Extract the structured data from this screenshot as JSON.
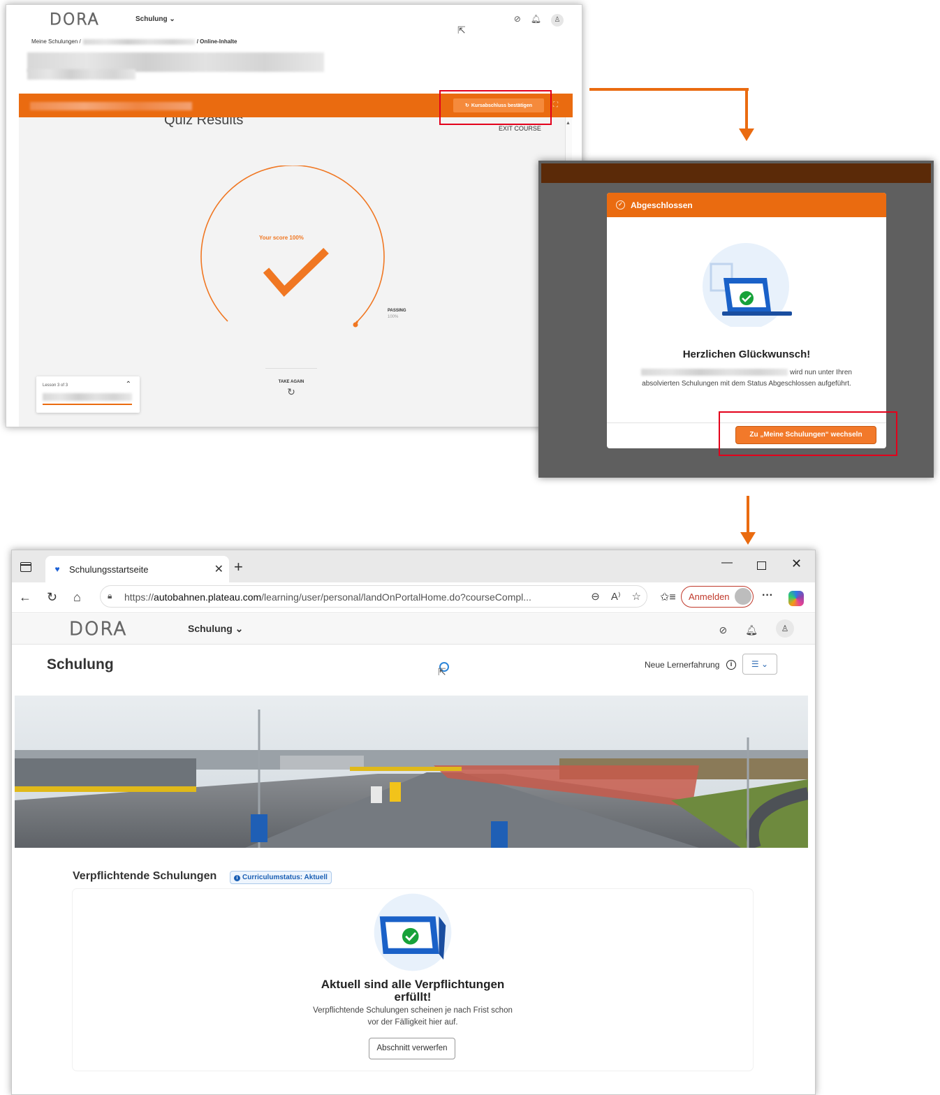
{
  "colors": {
    "accent": "#ea6b10",
    "highlight_box": "#e3001b",
    "link_blue": "#1a5fb4",
    "success_green": "#17a23a"
  },
  "lms": {
    "logo": "DORA",
    "menu_label": "Schulung",
    "breadcrumb_start": "Meine Schulungen /",
    "breadcrumb_end": "/ Online-Inhalte",
    "confirm_button": "Kursabschluss bestätigen",
    "quiz_title": "Quiz Results",
    "exit_course": "EXIT COURSE",
    "score_label": "Your score 100%",
    "score_percent": 100,
    "passing_label": "PASSING",
    "passing_value": "100%",
    "take_again": "TAKE AGAIN",
    "lesson_label": "Lesson 3 of 3",
    "icons": [
      "check-circle-icon",
      "bell-icon",
      "user-icon",
      "refresh-icon",
      "expand-icon",
      "chevron-up-icon",
      "retry-icon"
    ]
  },
  "dialog": {
    "header": "Abgeschlossen",
    "title": "Herzlichen Glückwunsch!",
    "text_line1_suffix": "wird nun unter Ihren",
    "text_line2": "absolvierten Schulungen mit dem Status Abgeschlossen aufgeführt.",
    "button": "Zu „Meine Schulungen“ wechseln"
  },
  "browser": {
    "tab_title": "Schulungsstartseite",
    "url_prefix": "https://",
    "url_host": "autobahnen.plateau.com",
    "url_path": "/learning/user/personal/landOnPortalHome.do?courseCompl...",
    "signin_label": "Anmelden",
    "window_controls": [
      "minimize-icon",
      "maximize-icon",
      "close-icon"
    ]
  },
  "portal": {
    "logo": "DORA",
    "menu_label": "Schulung",
    "page_title": "Schulung",
    "new_experience": "Neue Lernerfahrung",
    "section_title": "Verpflichtende Schulungen",
    "curriculum_badge": "Curriculumstatus: Aktuell",
    "empty_title_line1": "Aktuell sind alle Verpflichtungen",
    "empty_title_line2": "erfüllt!",
    "empty_text_line1": "Verpflichtende Schulungen scheinen je nach Frist schon",
    "empty_text_line2": "vor der Fälligkeit hier auf.",
    "discard_button": "Abschnitt verwerfen"
  }
}
